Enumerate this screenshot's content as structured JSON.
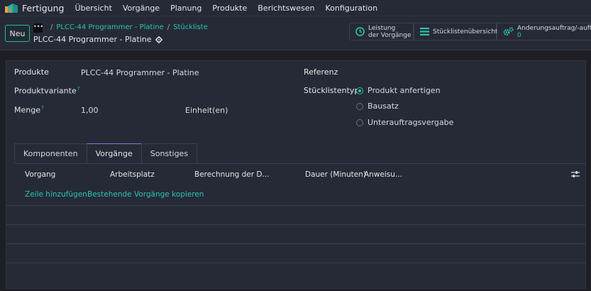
{
  "app": {
    "title": "Fertigung",
    "menu": [
      "Übersicht",
      "Vorgänge",
      "Planung",
      "Produkte",
      "Berichtswesen",
      "Konfiguration"
    ]
  },
  "controlbar": {
    "new_label": "Neu",
    "breadcrumb_dots": "•••",
    "breadcrumbs": [
      "PLCC-44 Programmer - Platine",
      "Stückliste"
    ],
    "record_title": "PLCC-44 Programmer - Platine",
    "smart_buttons": [
      {
        "line1": "Leistung",
        "line2": "der Vorgänge",
        "icon": "clock-icon"
      },
      {
        "line1": "Stücklistenübersicht",
        "line2": "",
        "icon": "list-icon"
      },
      {
        "line1": "Änderungsauftrag/-aufträ",
        "line2": "0",
        "icon": "gears-icon"
      }
    ]
  },
  "form": {
    "product_label": "Produkte",
    "product_value": "PLCC-44 Programmer - Platine",
    "variant_label": "Produktvariante",
    "variant_help": "?",
    "qty_label": "Menge",
    "qty_help": "?",
    "qty_value": "1,00",
    "uom_value": "Einheit(en)",
    "reference_label": "Referenz",
    "bom_type_label": "Stücklistentyp",
    "bom_types": [
      {
        "label": "Produkt anfertigen",
        "selected": true
      },
      {
        "label": "Bausatz",
        "selected": false
      },
      {
        "label": "Unterauftragsvergabe",
        "selected": false
      }
    ]
  },
  "tabs": [
    {
      "label": "Komponenten",
      "active": false
    },
    {
      "label": "Vorgänge",
      "active": true
    },
    {
      "label": "Sonstiges",
      "active": false
    }
  ],
  "table": {
    "columns": [
      "Vorgang",
      "Arbeitsplatz",
      "Berechnung der D...",
      "Dauer (Minuten)",
      "Anweisu..."
    ],
    "actions": [
      "Zeile hinzufügen",
      "Bestehende Vorgänge kopieren"
    ]
  },
  "colors": {
    "accent": "#2bc4b2",
    "tab_active": "#7f7bd6",
    "background": "#1e1f25",
    "panel": "#262a36"
  }
}
